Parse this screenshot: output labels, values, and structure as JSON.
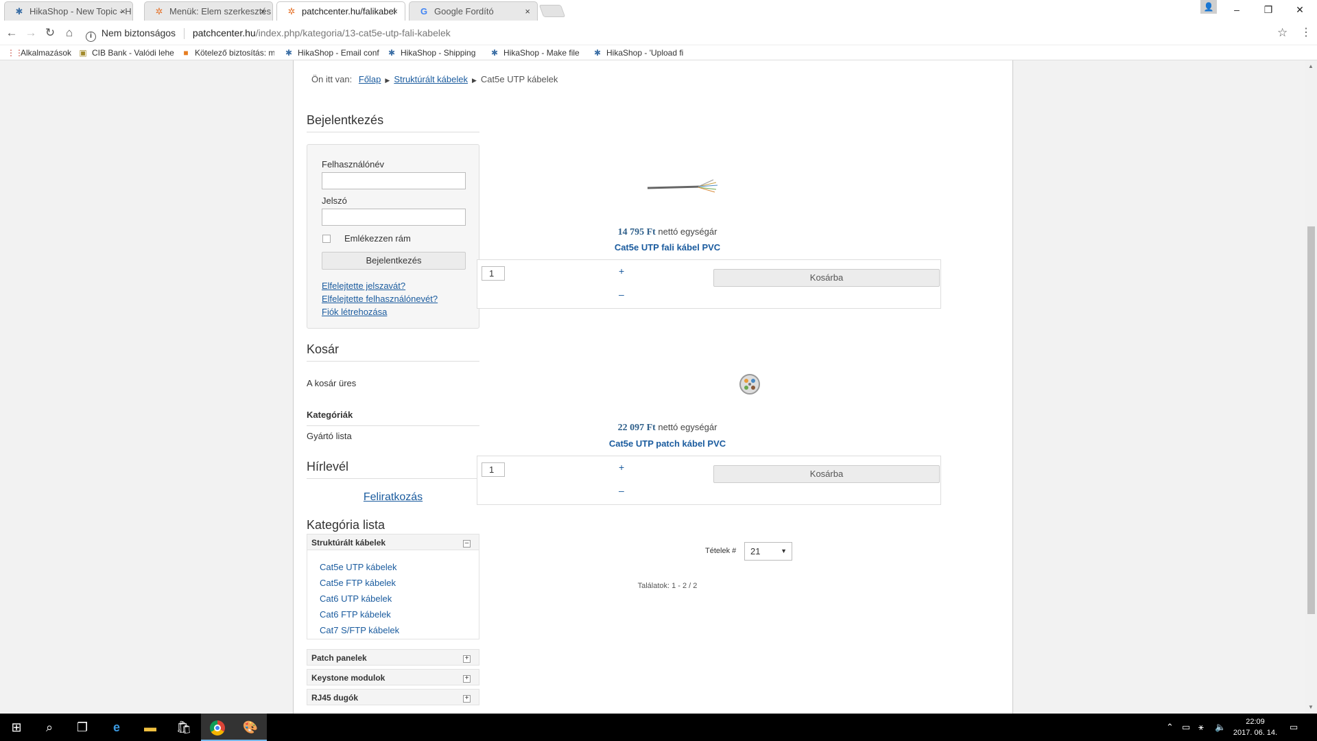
{
  "tabs": [
    {
      "title": "HikaShop - New Topic - H",
      "icon": "hikashop-icon",
      "close": "×"
    },
    {
      "title": "Menük: Elem szerkesztés",
      "icon": "joomla-icon",
      "close": "×"
    },
    {
      "title": "patchcenter.hu/falikabel",
      "icon": "joomla-icon",
      "close": "×"
    },
    {
      "title": "Google Fordító",
      "icon": "google-translate-icon",
      "close": "×"
    }
  ],
  "window": {
    "minimize": "–",
    "restore": "❐",
    "close": "✕",
    "user": "👤"
  },
  "address": {
    "security_label": "Nem biztonságos",
    "host": "patchcenter.hu",
    "path": "/index.php/kategoria/13-cat5e-utp-fali-kabelek"
  },
  "bookmarks": [
    {
      "label": "Alkalmazások",
      "icon": "apps-grid-icon"
    },
    {
      "label": "CIB Bank - Valódi lehe",
      "icon": "cib-icon"
    },
    {
      "label": "Kötelező biztosítás: m",
      "icon": "insurance-icon"
    },
    {
      "label": "HikaShop - Email conf",
      "icon": "hikashop-icon"
    },
    {
      "label": "HikaShop - Shipping",
      "icon": "hikashop-icon"
    },
    {
      "label": "HikaShop - Make file",
      "icon": "hikashop-icon"
    },
    {
      "label": "HikaShop - 'Upload fi",
      "icon": "hikashop-icon"
    }
  ],
  "breadcrumb": {
    "prefix": "Ön itt van:",
    "items": [
      "Főlap",
      "Struktúrált kábelek",
      "Cat5e UTP kábelek"
    ]
  },
  "login": {
    "heading": "Bejelentkezés",
    "username_label": "Felhasználónév",
    "username_value": "",
    "password_label": "Jelszó",
    "password_value": "",
    "remember_label": "Emlékezzen rám",
    "remember_checked": false,
    "submit": "Bejelentkezés",
    "links": [
      "Elfelejtette jelszavát?",
      "Elfelejtette felhasználónevét?",
      "Fiók létrehozása"
    ]
  },
  "cart": {
    "heading": "Kosár",
    "empty_text": "A kosár üres"
  },
  "categories": {
    "heading": "Kategóriák",
    "manufacturers": "Gyártó lista"
  },
  "newsletter": {
    "heading": "Hírlevél",
    "subscribe": "Feliratkozás"
  },
  "category_list": {
    "heading": "Kategória lista",
    "groups": [
      {
        "name": "Struktúrált kábelek",
        "toggle": "–",
        "expanded": true,
        "items": [
          "Cat5e UTP kábelek",
          "Cat5e FTP kábelek",
          "Cat6 UTP kábelek",
          "Cat6 FTP kábelek",
          "Cat7 S/FTP kábelek"
        ]
      },
      {
        "name": "Patch panelek",
        "toggle": "+",
        "expanded": false
      },
      {
        "name": "Keystone modulok",
        "toggle": "+",
        "expanded": false
      },
      {
        "name": "RJ45 dugók",
        "toggle": "+",
        "expanded": false
      }
    ]
  },
  "products": [
    {
      "price": "14 795 Ft",
      "price_note": "nettó egységár",
      "name": "Cat5e UTP fali kábel PVC",
      "qty": "1",
      "plus": "+",
      "minus": "–",
      "add_to_cart": "Kosárba",
      "image": "utp-cable-image"
    },
    {
      "price": "22 097 Ft",
      "price_note": "nettó egységár",
      "name": "Cat5e UTP patch kábel PVC",
      "qty": "1",
      "plus": "+",
      "minus": "–",
      "add_to_cart": "Kosárba",
      "image": "cable-cross-section-image"
    }
  ],
  "pagination": {
    "per_page_label": "Tételek #",
    "per_page_value": "21",
    "results": "Találatok: 1 - 2 / 2"
  },
  "taskbar": {
    "items": [
      "start-icon",
      "search-icon",
      "task-view-icon",
      "edge-icon",
      "file-explorer-icon",
      "store-icon",
      "chrome-icon",
      "paint-icon"
    ],
    "clock_time": "22:09",
    "clock_date": "2017. 06. 14."
  }
}
